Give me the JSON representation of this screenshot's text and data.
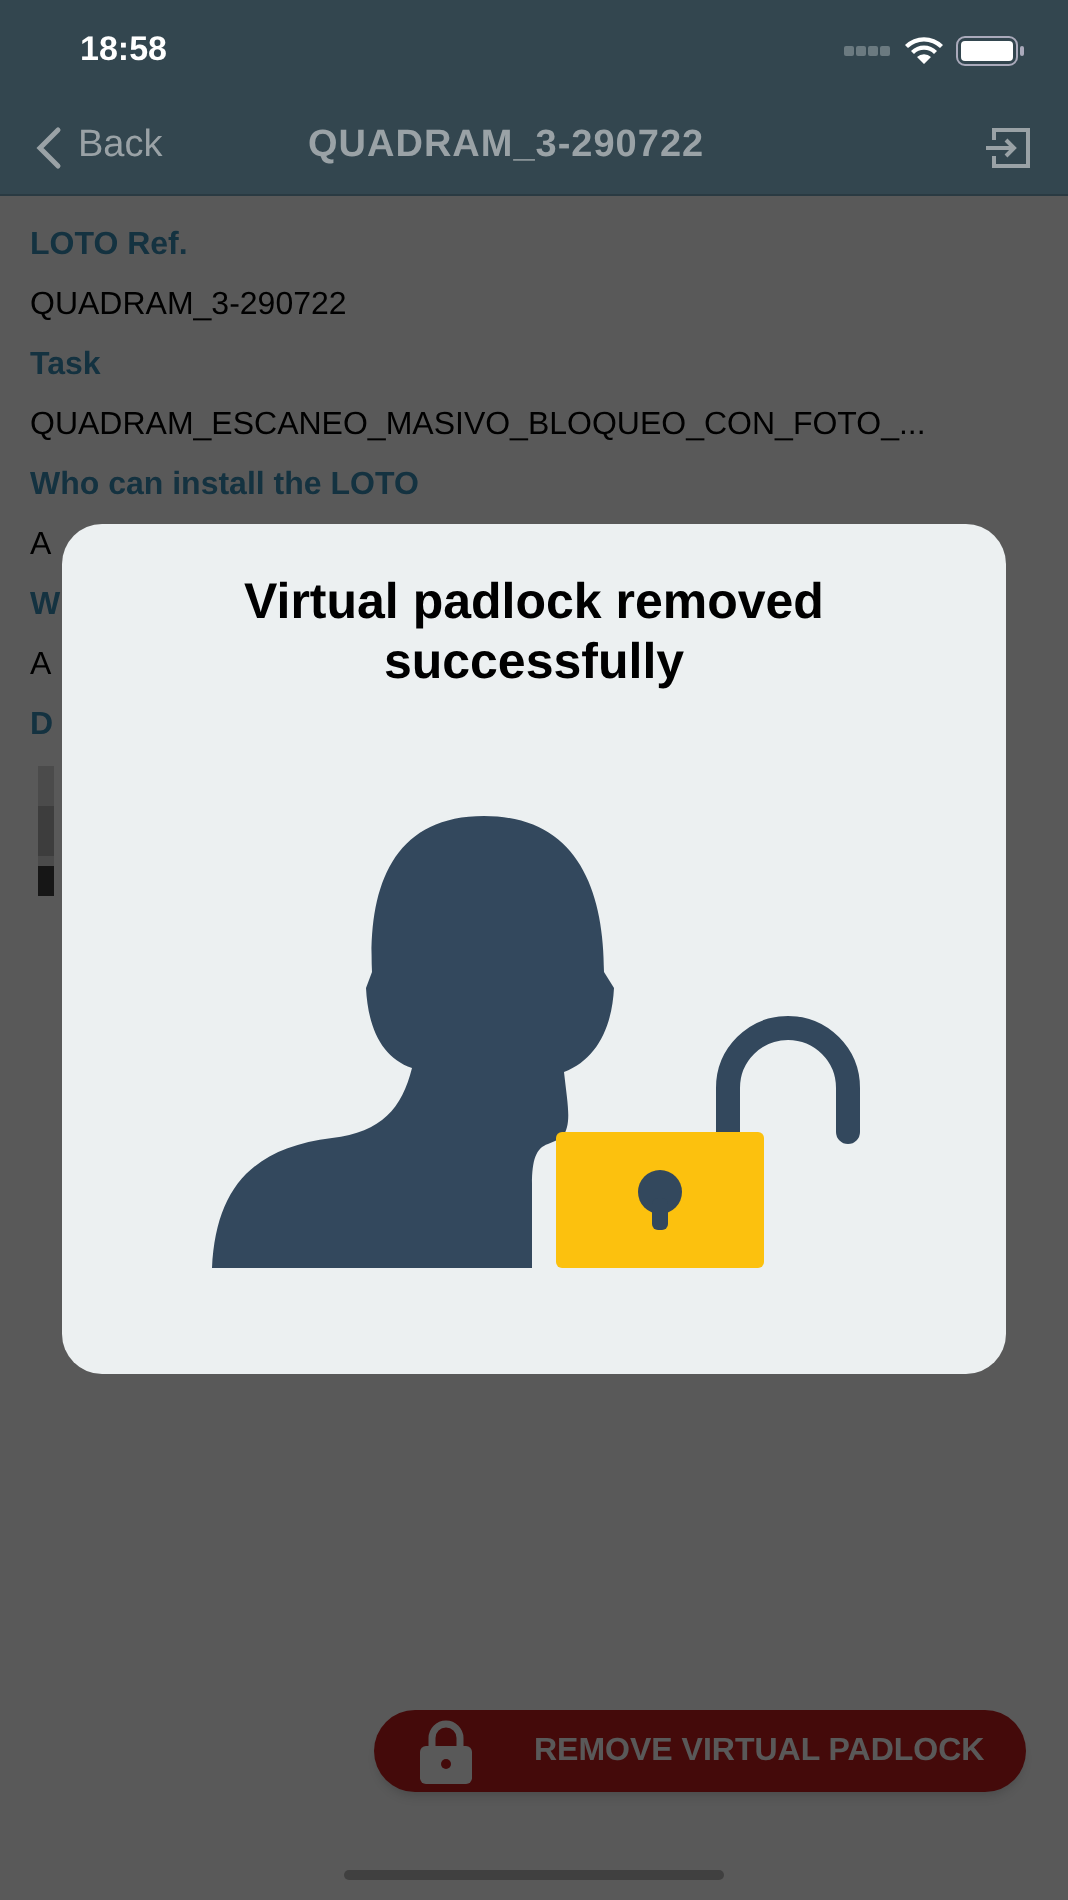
{
  "status_bar": {
    "time": "18:58"
  },
  "nav_bar": {
    "back": "Back",
    "title": "QUADRAM_3-290722"
  },
  "details": [
    {
      "kind": "label",
      "text": "LOTO Ref."
    },
    {
      "kind": "value",
      "text": "QUADRAM_3-290722"
    },
    {
      "kind": "label",
      "text": "Task"
    },
    {
      "kind": "value",
      "text": "QUADRAM_ESCANEO_MASIVO_BLOQUEO_CON_FOTO_..."
    },
    {
      "kind": "label",
      "text": "Who can install the LOTO"
    },
    {
      "kind": "value",
      "text": "A"
    },
    {
      "kind": "label",
      "text": "W"
    },
    {
      "kind": "value",
      "text": "A"
    },
    {
      "kind": "label",
      "text": "D"
    },
    {
      "kind": "picture"
    }
  ],
  "dialog": {
    "title": "Virtual padlock removed successfully"
  },
  "action_button": {
    "label": "REMOVE VIRTUAL PADLOCK"
  }
}
